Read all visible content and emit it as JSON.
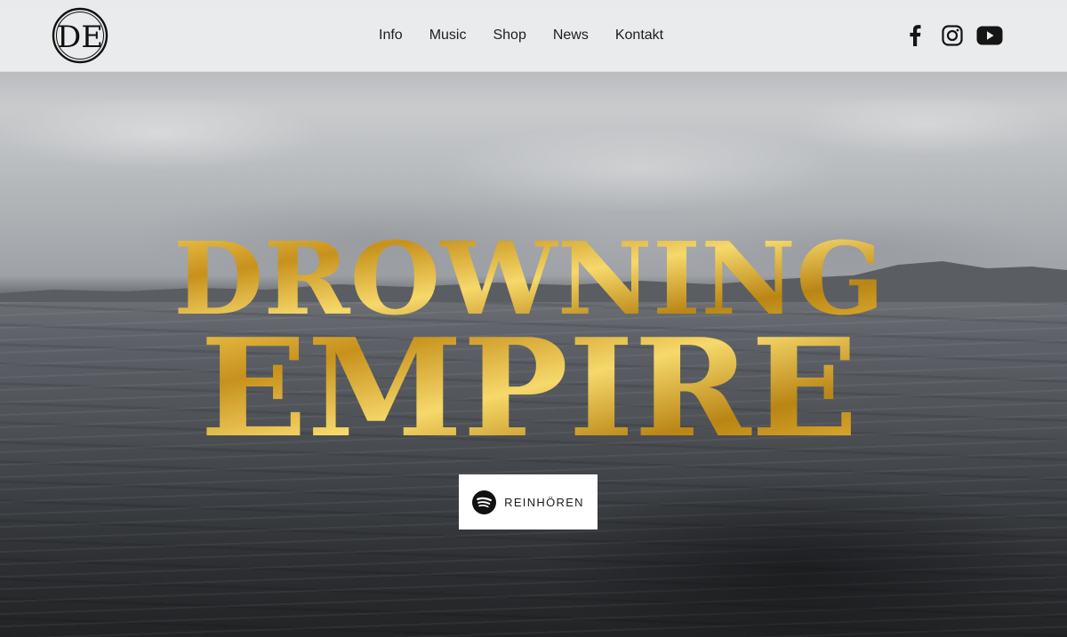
{
  "brand": {
    "logo_monogram": "DE",
    "logo_icon": "de-monogram-logo-icon"
  },
  "nav": {
    "items": [
      {
        "label": "Info"
      },
      {
        "label": "Music"
      },
      {
        "label": "Shop"
      },
      {
        "label": "News"
      },
      {
        "label": "Kontakt"
      }
    ]
  },
  "socials": {
    "facebook_icon": "facebook-icon",
    "instagram_icon": "instagram-icon",
    "youtube_icon": "youtube-icon"
  },
  "hero": {
    "title_line1": "DROWNING",
    "title_line2": "EMPIRE",
    "cta_label": "REINHÖREN",
    "cta_icon": "spotify-icon"
  },
  "colors": {
    "gold": "#d9a92a",
    "gold_light": "#f3cd55",
    "gold_dark": "#a77a12",
    "header_bg": "#ecedee",
    "text_dark": "#1d1d1f"
  }
}
